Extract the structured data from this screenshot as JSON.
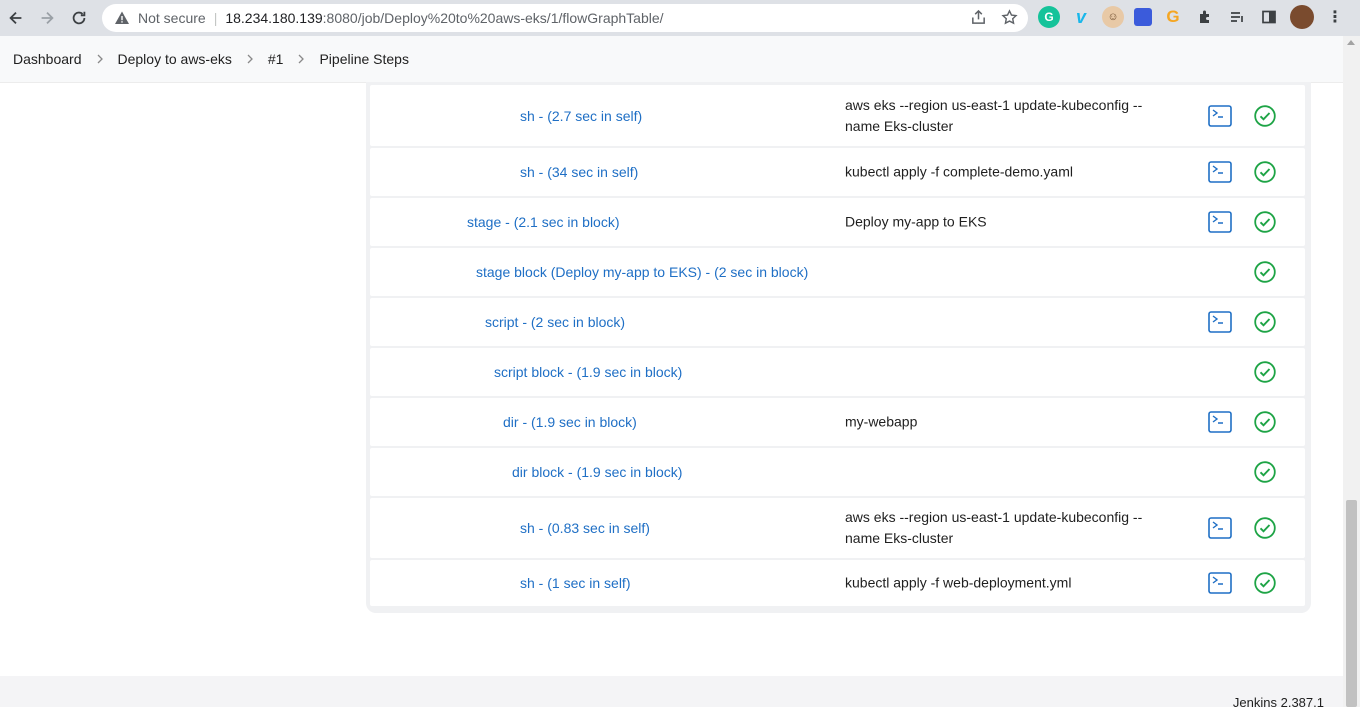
{
  "browser": {
    "not_secure_label": "Not secure",
    "url_host": "18.234.180.139",
    "url_path": ":8080/job/Deploy%20to%20aws-eks/1/flowGraphTable/"
  },
  "breadcrumb": {
    "items": [
      "Dashboard",
      "Deploy to aws-eks",
      "#1",
      "Pipeline Steps"
    ]
  },
  "steps": [
    {
      "label": "sh - (2.7 sec in self)",
      "arg_line1": "aws eks --region us-east-1 update-kubeconfig --",
      "arg_line2": "name Eks-cluster",
      "console": true,
      "status": "success"
    },
    {
      "label": "sh - (34 sec in self)",
      "arg_line1": "kubectl apply -f complete-demo.yaml",
      "arg_line2": "",
      "console": true,
      "status": "success"
    },
    {
      "label": "stage - (2.1 sec in block)",
      "arg_line1": "Deploy my-app to EKS",
      "arg_line2": "",
      "console": true,
      "status": "success"
    },
    {
      "label": "stage block (Deploy my-app to EKS) - (2 sec in block)",
      "arg_line1": "",
      "arg_line2": "",
      "console": false,
      "status": "success"
    },
    {
      "label": "script - (2 sec in block)",
      "arg_line1": "",
      "arg_line2": "",
      "console": true,
      "status": "success"
    },
    {
      "label": "script block - (1.9 sec in block)",
      "arg_line1": "",
      "arg_line2": "",
      "console": false,
      "status": "success"
    },
    {
      "label": "dir - (1.9 sec in block)",
      "arg_line1": "my-webapp",
      "arg_line2": "",
      "console": true,
      "status": "success"
    },
    {
      "label": "dir block - (1.9 sec in block)",
      "arg_line1": "",
      "arg_line2": "",
      "console": false,
      "status": "success"
    },
    {
      "label": "sh - (0.83 sec in self)",
      "arg_line1": "aws eks --region us-east-1 update-kubeconfig --",
      "arg_line2": "name Eks-cluster",
      "console": true,
      "status": "success"
    },
    {
      "label": "sh - (1 sec in self)",
      "arg_line1": "kubectl apply -f web-deployment.yml",
      "arg_line2": "",
      "console": true,
      "status": "success"
    }
  ],
  "footer": {
    "version": "Jenkins 2.387.1"
  },
  "icons": {
    "console": "terminal-icon",
    "status": "check-circle-icon"
  },
  "colors": {
    "link": "#1f6fc5",
    "success": "#1ea446",
    "console": "#1f6fc5"
  }
}
